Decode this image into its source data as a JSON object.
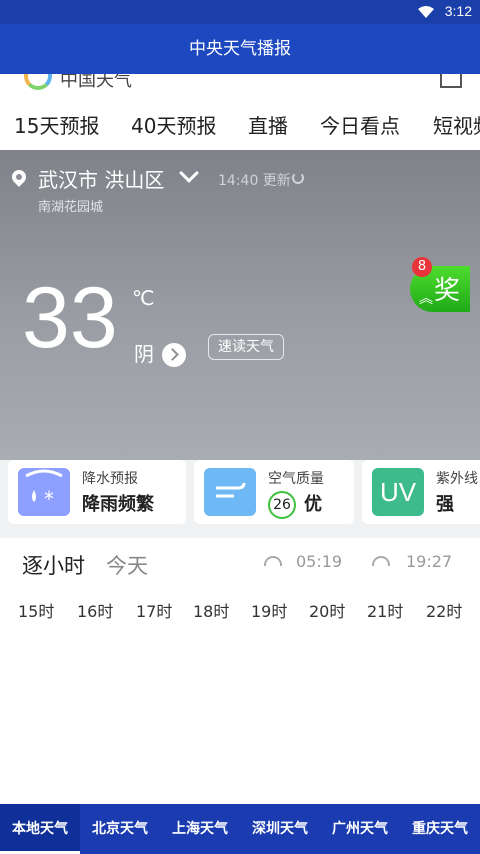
{
  "status_bar": {
    "time": "3:12"
  },
  "app_bar": {
    "title": "中央天气播报"
  },
  "brand": {
    "name": "中国天气"
  },
  "nav_tabs": [
    "15天预报",
    "40天预报",
    "直播",
    "今日看点",
    "短视频"
  ],
  "weather": {
    "location": "武汉市 洪山区",
    "update_time": "14:40 更新",
    "sub_location": "南湖花园城",
    "temperature": "33",
    "unit": "℃",
    "condition": "阴",
    "read_button": "速读天气",
    "reward_badge": "8",
    "reward_label": "奖"
  },
  "cards": [
    {
      "title": "降水预报",
      "value": "降雨频繁",
      "icon": "rain-snow-icon",
      "color": "#8ea0ff"
    },
    {
      "title": "空气质量",
      "aqi": "26",
      "value": "优",
      "icon": "wind-icon",
      "color": "#6db8f5"
    },
    {
      "title": "紫外线",
      "value": "强",
      "icon": "uv-icon",
      "icon_text": "UV",
      "color": "#3dbb8c"
    }
  ],
  "hourly": {
    "title": "逐小时",
    "today": "今天",
    "sunrise": "05:19",
    "sunset": "19:27",
    "hours": [
      "15时",
      "16时",
      "17时",
      "18时",
      "19时",
      "20时",
      "21时",
      "22时"
    ]
  },
  "bottom_tabs": [
    "本地天气",
    "北京天气",
    "上海天气",
    "深圳天气",
    "广州天气",
    "重庆天气"
  ]
}
